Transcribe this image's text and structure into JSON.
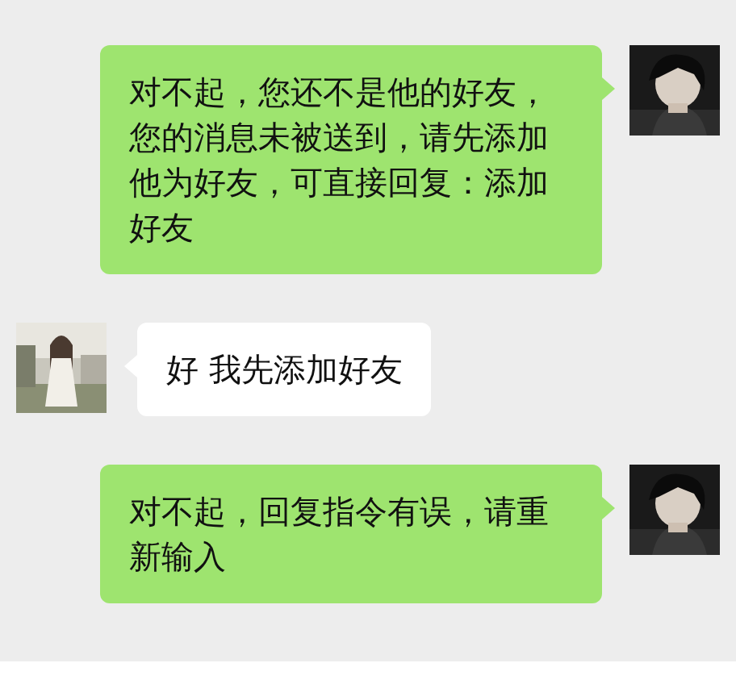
{
  "messages": [
    {
      "kind": "sent",
      "text": "对不起，您还不是他的好友，您的消息未被送到，请先添加他为好友，可直接回复：添加好友"
    },
    {
      "kind": "received",
      "text": "好 我先添加好友"
    },
    {
      "kind": "sent",
      "text": "对不起，回复指令有误，请重新输入"
    }
  ]
}
